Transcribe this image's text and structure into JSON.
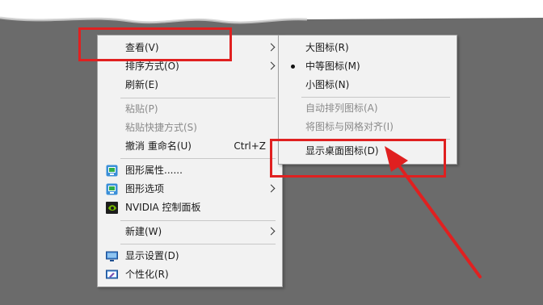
{
  "context_menu": {
    "items": [
      {
        "label": "查看(V)",
        "submenu": true
      },
      {
        "label": "排序方式(O)",
        "submenu": true
      },
      {
        "label": "刷新(E)"
      },
      {
        "label": "粘贴(P)",
        "disabled": true
      },
      {
        "label": "粘贴快捷方式(S)",
        "disabled": true
      },
      {
        "label": "撤消 重命名(U)",
        "shortcut": "Ctrl+Z"
      },
      {
        "label": "图形属性......",
        "icon": "intel-graphics-icon"
      },
      {
        "label": "图形选项",
        "icon": "intel-graphics-icon",
        "submenu": true
      },
      {
        "label": "NVIDIA 控制面板",
        "icon": "nvidia-icon"
      },
      {
        "label": "新建(W)",
        "submenu": true
      },
      {
        "label": "显示设置(D)",
        "icon": "display-icon"
      },
      {
        "label": "个性化(R)",
        "icon": "personalize-icon"
      }
    ]
  },
  "view_submenu": {
    "items": [
      {
        "label": "大图标(R)"
      },
      {
        "label": "中等图标(M)",
        "selected": true
      },
      {
        "label": "小图标(N)"
      },
      {
        "label": "自动排列图标(A)",
        "disabled": true
      },
      {
        "label": "将图标与网格对齐(I)",
        "disabled": true
      },
      {
        "label": "显示桌面图标(D)"
      }
    ]
  },
  "annotations": {
    "highlight_color": "#e02020"
  }
}
